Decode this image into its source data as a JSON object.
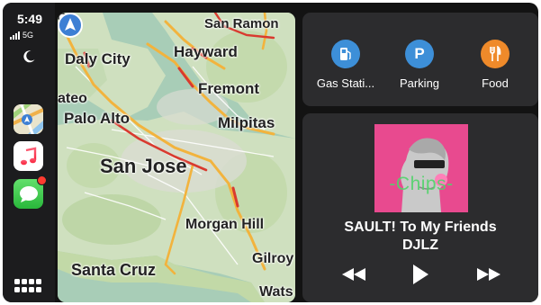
{
  "status": {
    "time": "5:49",
    "network": "5G",
    "icons": [
      "signal-icon",
      "moon-icon"
    ]
  },
  "dock": {
    "apps": [
      {
        "name": "Maps",
        "icon": "maps-icon"
      },
      {
        "name": "Music",
        "icon": "music-icon"
      },
      {
        "name": "Messages",
        "icon": "messages-icon",
        "badge": true
      }
    ],
    "home_icon": "app-grid-icon"
  },
  "map": {
    "labels": {
      "san_ramon": "San Ramon",
      "daly_city": "Daly City",
      "hayward": "Hayward",
      "fremont": "Fremont",
      "san_mateo": "ateo",
      "palo_alto": "Palo Alto",
      "milpitas": "Milpitas",
      "san_jose": "San Jose",
      "morgan_hill": "Morgan Hill",
      "santa_cruz": "Santa Cruz",
      "gilroy": "Gilroy",
      "watsonville": "Wats"
    },
    "colors": {
      "water": "#a8cdb7",
      "land": "#cfe0bf",
      "traffic_slow": "#f2b33d",
      "traffic_heavy": "#d93a2f",
      "nav": "#3d7fd4"
    }
  },
  "places": {
    "items": [
      {
        "label": "Gas Stati...",
        "icon": "gas-station-icon",
        "color": "#3d8fd8"
      },
      {
        "label": "Parking",
        "icon": "parking-icon",
        "color": "#3d8fd8"
      },
      {
        "label": "Food",
        "icon": "fork-knife-icon",
        "color": "#ef8a2a"
      }
    ]
  },
  "now_playing": {
    "album_art_text": "-Chips-",
    "title": "SAULT! To My Friends",
    "artist": "DJLZ",
    "controls": [
      "previous-icon",
      "play-icon",
      "next-icon"
    ]
  }
}
